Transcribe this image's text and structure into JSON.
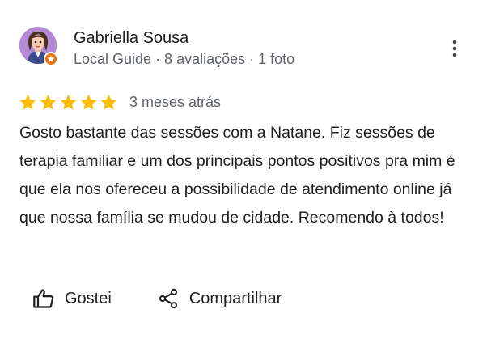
{
  "reviewer": {
    "name": "Gabriella Sousa",
    "meta": "Local Guide · 8 avaliações · 1 foto"
  },
  "review": {
    "rating": 5,
    "max_rating": 5,
    "date": "3 meses atrás",
    "text": "Gosto bastante das sessões com a Natane. Fiz sessões de terapia familiar e um dos principais pontos positivos pra mim é que ela nos ofereceu a possibilidade de atendimento online já que nossa família se mudou de cidade. Recomendo à todos!"
  },
  "actions": {
    "like_label": "Gostei",
    "share_label": "Compartilhar"
  },
  "icons": {
    "more": "more-vert-icon",
    "like": "thumb-up-icon",
    "share": "share-icon",
    "star": "star-icon",
    "badge": "local-guide-badge-icon"
  },
  "colors": {
    "star": "#fbbc04",
    "badge": "#e8710a",
    "text": "#1f1f1f",
    "secondary_text": "#5f6368"
  }
}
